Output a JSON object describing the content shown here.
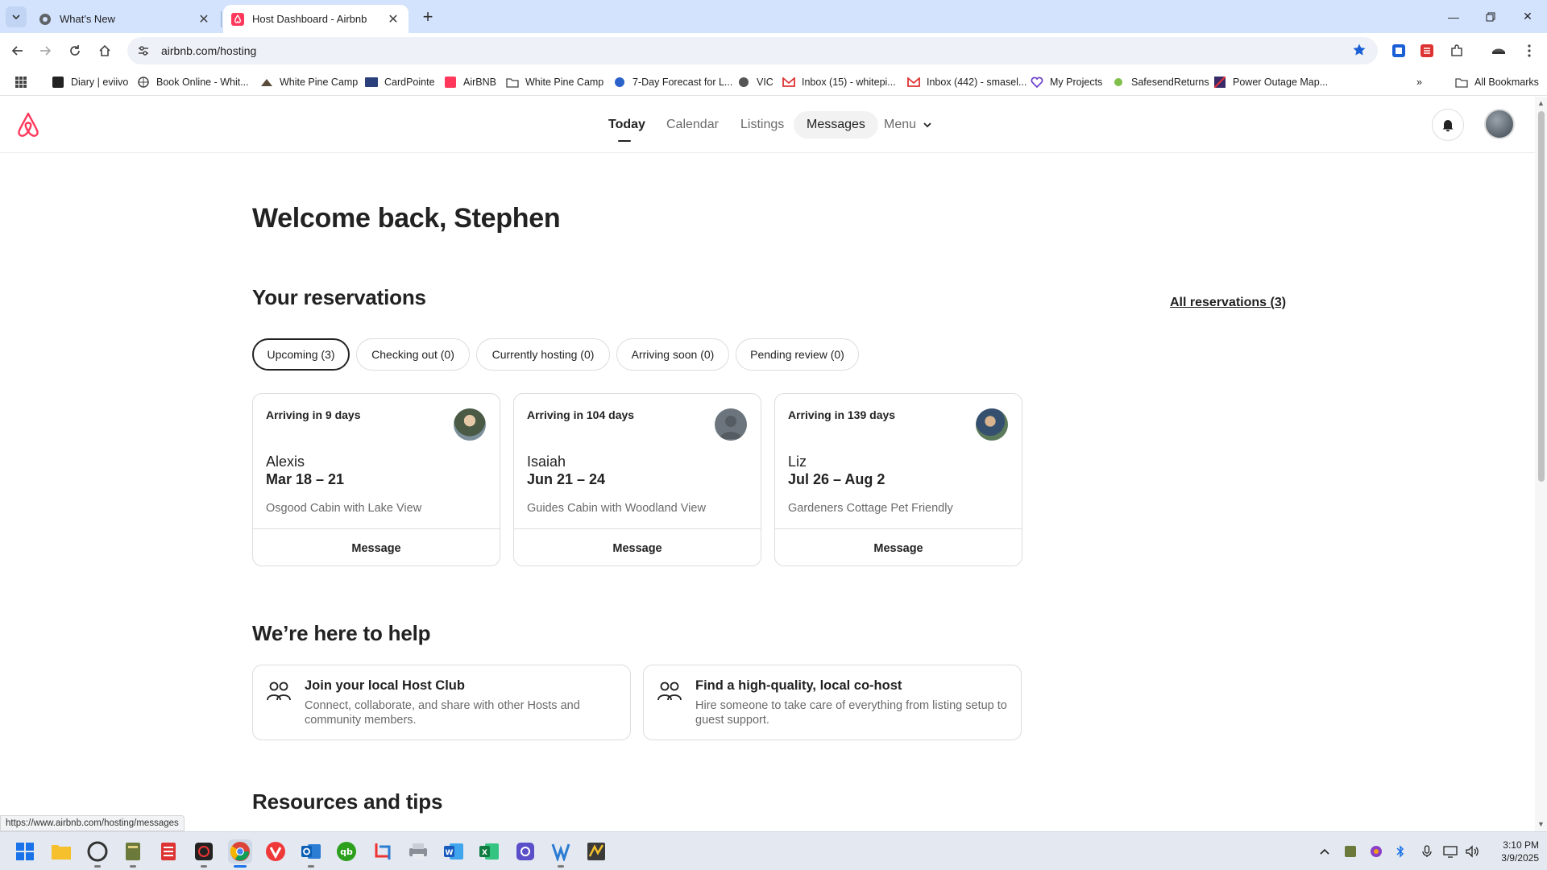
{
  "browser": {
    "tabs": [
      {
        "title": "What's New"
      },
      {
        "title": "Host Dashboard - Airbnb"
      }
    ],
    "url": "airbnb.com/hosting",
    "bookmarks": [
      {
        "label": "Diary | eviivo"
      },
      {
        "label": "Book Online - Whit..."
      },
      {
        "label": "White Pine Camp"
      },
      {
        "label": "CardPointe"
      },
      {
        "label": "AirBNB"
      },
      {
        "label": "White Pine Camp"
      },
      {
        "label": "7-Day Forecast for L..."
      },
      {
        "label": "VIC"
      },
      {
        "label": "Inbox (15) - whitepi..."
      },
      {
        "label": "Inbox (442) - smasel..."
      },
      {
        "label": "My Projects"
      },
      {
        "label": "SafesendReturns"
      },
      {
        "label": "Power Outage Map..."
      }
    ],
    "all_bookmarks": "All Bookmarks",
    "status_url": "https://www.airbnb.com/hosting/messages"
  },
  "nav": {
    "today": "Today",
    "calendar": "Calendar",
    "listings": "Listings",
    "messages": "Messages",
    "menu": "Menu"
  },
  "welcome": "Welcome back, Stephen",
  "reservations": {
    "title": "Your reservations",
    "all_link": "All reservations (3)",
    "filters": [
      "Upcoming (3)",
      "Checking out (0)",
      "Currently hosting (0)",
      "Arriving soon (0)",
      "Pending review (0)"
    ],
    "cards": [
      {
        "arrival": "Arriving in 9 days",
        "guest": "Alexis",
        "dates": "Mar 18 – 21",
        "listing": "Osgood Cabin with Lake View",
        "action": "Message"
      },
      {
        "arrival": "Arriving in 104 days",
        "guest": "Isaiah",
        "dates": "Jun 21 – 24",
        "listing": "Guides Cabin with Woodland View",
        "action": "Message"
      },
      {
        "arrival": "Arriving in 139 days",
        "guest": "Liz",
        "dates": "Jul 26 – Aug 2",
        "listing": "Gardeners Cottage Pet Friendly",
        "action": "Message"
      }
    ]
  },
  "help": {
    "title": "We’re here to help",
    "cards": [
      {
        "title": "Join your local Host Club",
        "desc": "Connect, collaborate, and share with other Hosts and community members."
      },
      {
        "title": "Find a high-quality, local co-host",
        "desc": "Hire someone to take care of everything from listing setup to guest support."
      }
    ]
  },
  "resources": {
    "title": "Resources and tips"
  },
  "taskbar": {
    "time": "3:10 PM",
    "date": "3/9/2025"
  },
  "colors": {
    "brand": "#FF385C",
    "text": "#222222",
    "muted": "#6A6A6A",
    "border": "#DDDDDD"
  }
}
